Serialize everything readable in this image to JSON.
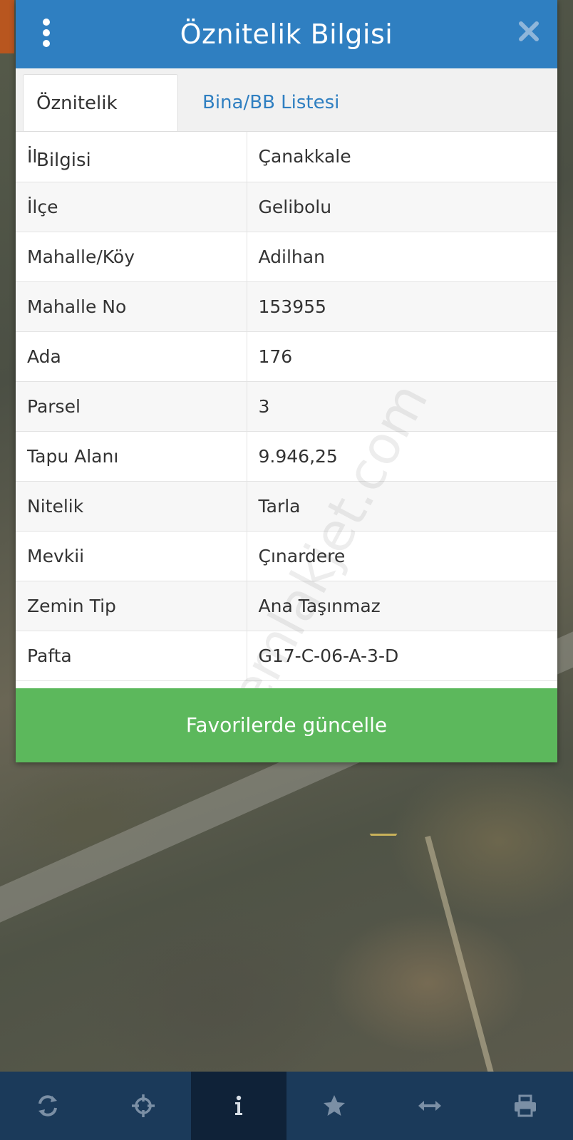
{
  "dialog": {
    "title": "Öznitelik Bilgisi",
    "tabs": [
      {
        "label": "Öznitelik Bilgisi",
        "active": true
      },
      {
        "label": "Bina/BB Listesi",
        "active": false
      }
    ],
    "rows": [
      {
        "key": "İl",
        "value": "Çanakkale"
      },
      {
        "key": "İlçe",
        "value": "Gelibolu"
      },
      {
        "key": "Mahalle/Köy",
        "value": "Adilhan"
      },
      {
        "key": "Mahalle No",
        "value": "153955"
      },
      {
        "key": "Ada",
        "value": "176"
      },
      {
        "key": "Parsel",
        "value": "3"
      },
      {
        "key": "Tapu Alanı",
        "value": "9.946,25"
      },
      {
        "key": "Nitelik",
        "value": "Tarla"
      },
      {
        "key": "Mevkii",
        "value": "Çınardere"
      },
      {
        "key": "Zemin Tip",
        "value": "Ana Taşınmaz"
      },
      {
        "key": "Pafta",
        "value": "G17-C-06-A-3-D"
      }
    ],
    "update_button": "Favorilerde güncelle"
  },
  "watermark": "emlakjet.com",
  "toolbar": {
    "icons": [
      "refresh-icon",
      "locate-icon",
      "info-icon",
      "star-icon",
      "measure-icon",
      "print-icon"
    ],
    "active_index": 2
  },
  "colors": {
    "header": "#2f7fc1",
    "button": "#5cb85c",
    "toolbar": "#1b3a5a",
    "toolbar_active": "#0f2238"
  }
}
